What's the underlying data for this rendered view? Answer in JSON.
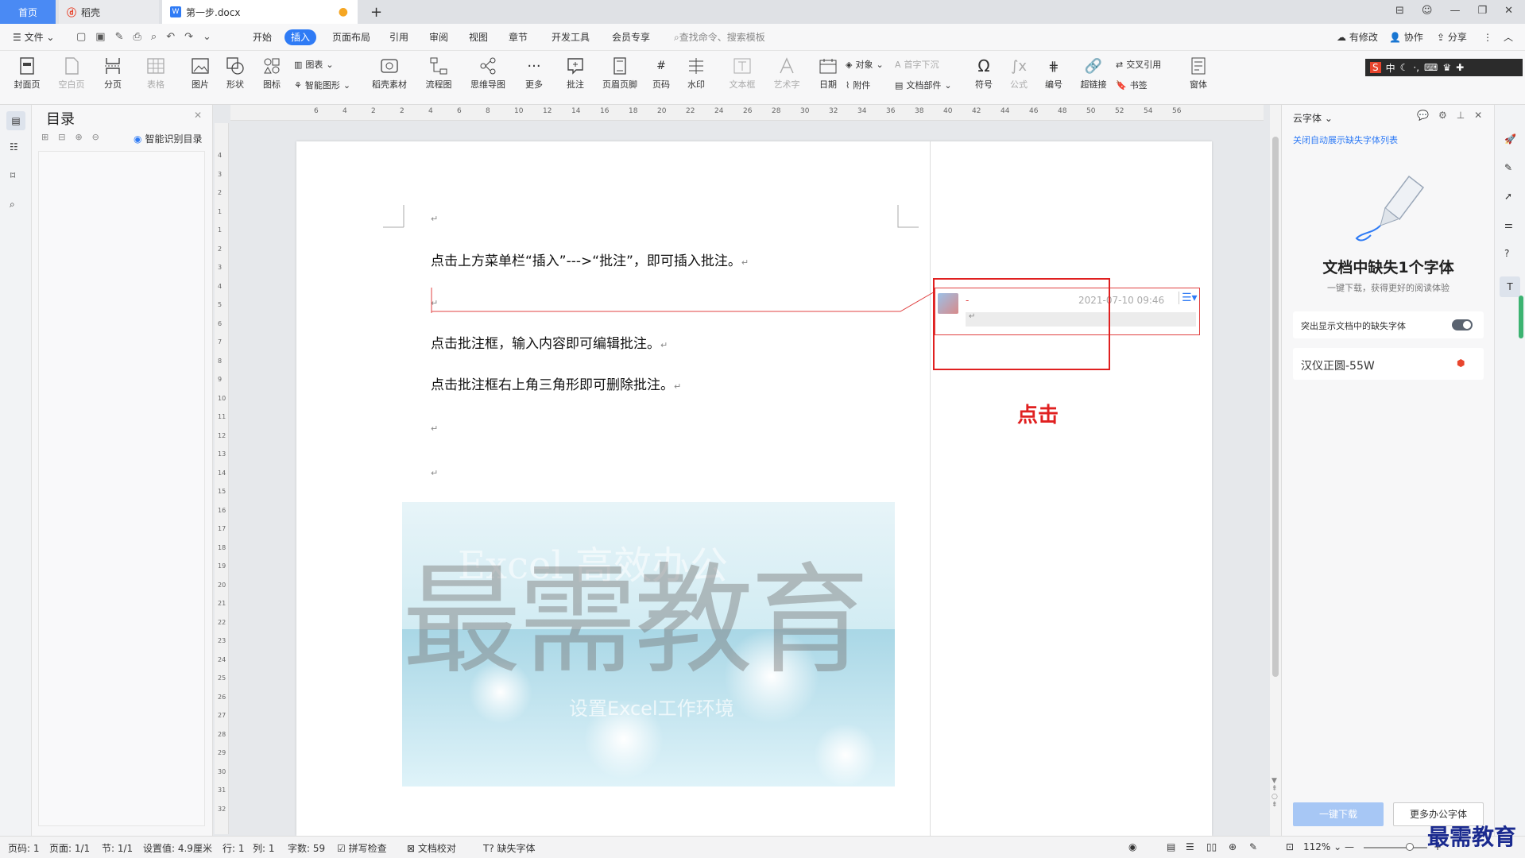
{
  "tabs": {
    "home": "首页",
    "docer": "稻壳",
    "doc": "第一步.docx",
    "add": "+"
  },
  "menubar": {
    "file": "文件",
    "items": [
      "开始",
      "插入",
      "页面布局",
      "引用",
      "审阅",
      "视图",
      "章节",
      "开发工具",
      "会员专享"
    ],
    "active": "插入",
    "search_placeholder": "查找命令、搜索模板",
    "right": [
      "有修改",
      "协作",
      "分享"
    ]
  },
  "ribbon": {
    "cover": "封面页",
    "blank": "空白页",
    "break": "分页",
    "table": "表格",
    "picture": "图片",
    "shape": "形状",
    "icon": "图标",
    "chart": "图表",
    "smartart": "智能图形",
    "material": "稻壳素材",
    "flow": "流程图",
    "mind": "思维导图",
    "more": "更多",
    "comment": "批注",
    "header": "页眉页脚",
    "pagenum": "页码",
    "watermark": "水印",
    "textbox": "文本框",
    "wordart": "艺术字",
    "date": "日期",
    "object": "对象",
    "dropcap": "首字下沉",
    "attach": "附件",
    "docpart": "文档部件",
    "symbol": "符号",
    "formula": "公式",
    "number": "编号",
    "hyperlink": "超链接",
    "crossref": "交叉引用",
    "bookmark": "书签",
    "window": "窗体"
  },
  "ime": "中",
  "toc": {
    "title": "目录",
    "smart": "智能识别目录"
  },
  "ruler": {
    "h": [
      "6",
      "4",
      "2",
      "2",
      "4",
      "6",
      "8",
      "10",
      "12",
      "14",
      "16",
      "18",
      "20",
      "22",
      "24",
      "26",
      "28",
      "30",
      "32",
      "34",
      "36",
      "38",
      "40",
      "42",
      "44",
      "46",
      "48",
      "50",
      "52",
      "54",
      "56"
    ],
    "v": [
      "4",
      "3",
      "2",
      "1",
      "1",
      "2",
      "3",
      "4",
      "5",
      "6",
      "7",
      "8",
      "9",
      "10",
      "11",
      "12",
      "13",
      "14",
      "15",
      "16",
      "17",
      "18",
      "19",
      "20",
      "21",
      "22",
      "23",
      "24",
      "25",
      "26",
      "27",
      "28",
      "29",
      "30",
      "31",
      "32"
    ]
  },
  "document": {
    "para1": "点击上方菜单栏“插入”--->“批注”，即可插入批注。",
    "para2": "点击批注框，输入内容即可编辑批注。",
    "para3": "点击批注框右上角三角形即可删除批注。",
    "mark": "↵"
  },
  "image_text": {
    "big": "最需教育",
    "line1": "Excel 高效办公",
    "line2": "设置Excel工作环境"
  },
  "comment": {
    "author": "-",
    "timestamp": "2021-07-10 09:46",
    "body": "↵"
  },
  "annotation": {
    "label": "点击",
    "color": "#e02020"
  },
  "right_panel": {
    "header": "云字体",
    "close_list": "关闭自动展示缺失字体列表",
    "title": "文档中缺失1个字体",
    "subtitle": "一键下载，获得更好的阅读体验",
    "toggle_label": "突出显示文档中的缺失字体",
    "font_name": "汉仪正圆-55W",
    "download_btn": "一键下载",
    "more_btn": "更多办公字体"
  },
  "status": {
    "pagecode": "页码: 1",
    "page": "页面: 1/1",
    "section": "节: 1/1",
    "setting": "设置值: 4.9厘米",
    "row": "行: 1",
    "col": "列: 1",
    "words": "字数: 59",
    "spell": "拼写检查",
    "proof": "文档校对",
    "missing": "缺失字体",
    "zoom": "112%"
  },
  "watermark_logo": "最需教育",
  "colors": {
    "accent": "#2f7bf5",
    "insert_tab": "#2f7bf5",
    "red": "#e02020"
  }
}
